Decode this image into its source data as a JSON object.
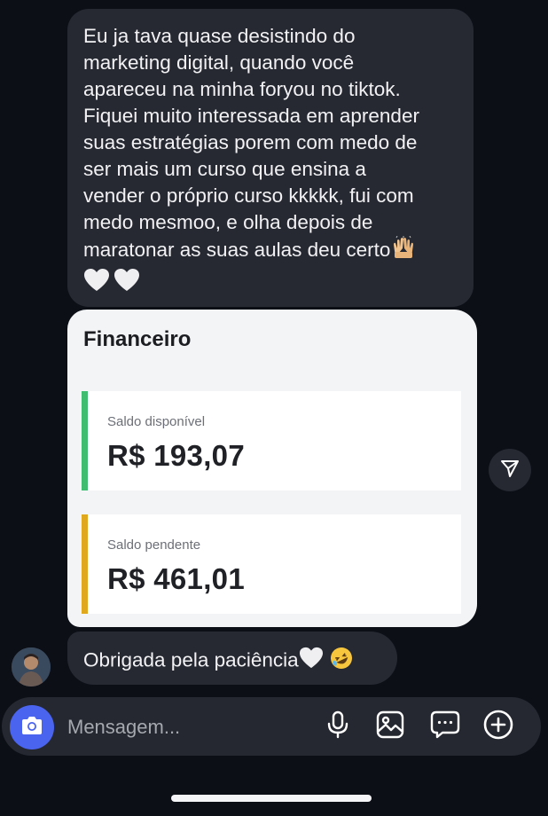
{
  "messages": {
    "first": {
      "lines": [
        "Eu ja tava quase desistindo do",
        "marketing digital, quando você",
        "apareceu na minha foryou no tiktok.",
        "Fiquei muito interessada em aprender",
        "suas estratégias porem com medo de",
        "ser mais um curso que ensina a",
        "vender o próprio curso kkkkk, fui com",
        "medo mesmoo, e olha depois de",
        "maratonar  as suas aulas deu certo"
      ]
    },
    "third": {
      "text": "Obrigada pela paciência"
    }
  },
  "shared_card": {
    "title": "Financeiro",
    "available_label": "Saldo disponível",
    "available_value": "R$ 193,07",
    "pending_label": "Saldo pendente",
    "pending_value": "R$ 461,01",
    "available_color": "#3ebd70",
    "pending_color": "#e0a81c"
  },
  "composer": {
    "placeholder": "Mensagem...",
    "camera_color": "#4a64f0"
  },
  "icons": {
    "share": "paper-plane-icon",
    "camera": "camera-icon",
    "mic": "microphone-icon",
    "gallery": "gallery-icon",
    "sticker": "sticker-icon",
    "plus": "plus-icon"
  }
}
